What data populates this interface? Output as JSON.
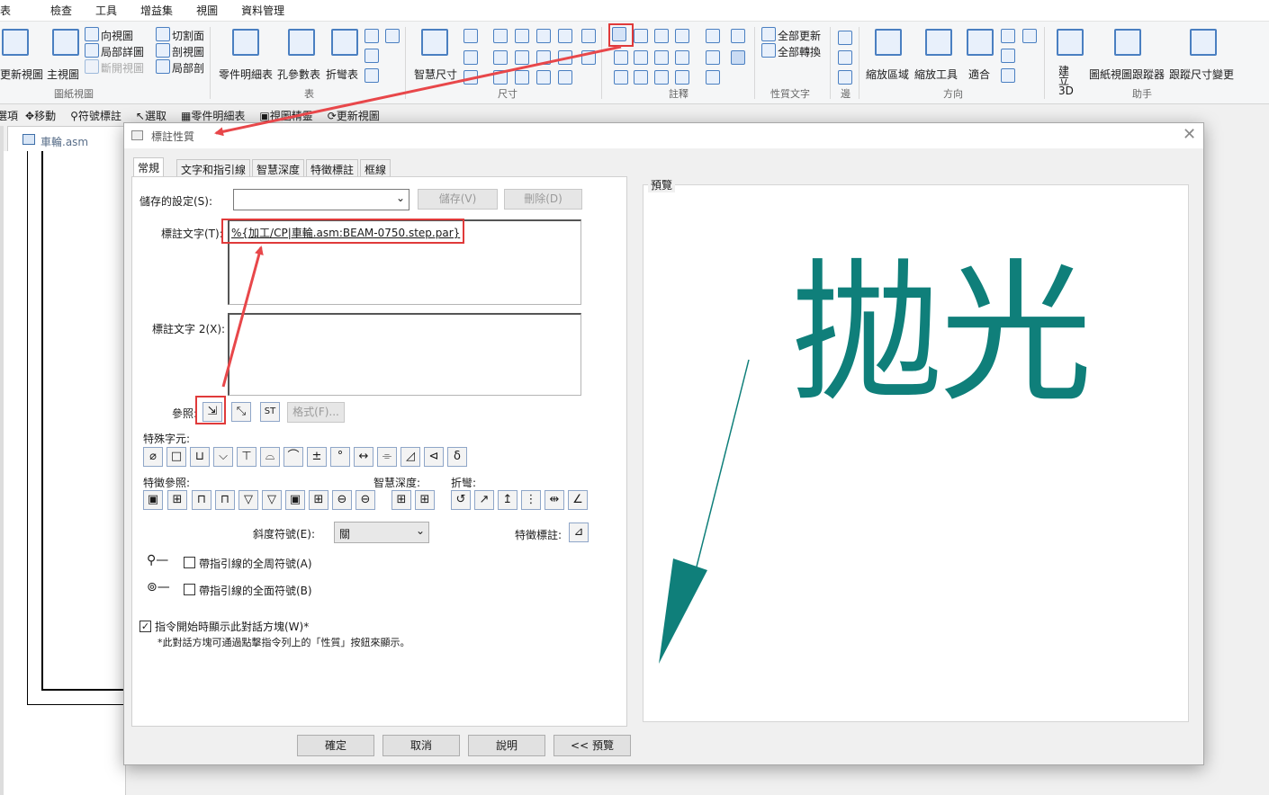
{
  "menubar": {
    "items": [
      "表",
      "檢查",
      "工具",
      "增益集",
      "視圖",
      "資料管理"
    ]
  },
  "ribbon": {
    "groups": {
      "drawing_views": "圖紙視圖",
      "tables": "表",
      "dimension": "尺寸",
      "annotation": "註釋",
      "property_text": "性質文字",
      "edge": "邊",
      "orientation": "方向",
      "assistant": "助手"
    },
    "buttons": {
      "update_views": "更新視圖",
      "main_view": "主視圖",
      "view_dir": "向視圖",
      "detail": "局部詳圖",
      "broken": "斷開視圖",
      "section": "切割面",
      "section_view": "剖視圖",
      "partial_section": "局部剖",
      "parts_list": "零件明細表",
      "hole_table": "孔參數表",
      "bend_table": "折彎表",
      "smart_dim": "智慧尺寸",
      "update_all": "全部更新",
      "convert_all": "全部轉換",
      "zoom_area": "縮放區域",
      "zoom_tool": "縮放工具",
      "fit": "適合",
      "create_3d": "建立3D",
      "view_tracker": "圖紙視圖跟蹤器",
      "track_dim": "跟蹤尺寸變更"
    }
  },
  "quickbar": {
    "items": [
      "選項",
      "移動",
      "符號標註",
      "選取",
      "零件明細表",
      "視圖精靈",
      "更新視圖"
    ]
  },
  "document": {
    "tab_name": "車輪.asm"
  },
  "dialog": {
    "title": "標註性質",
    "tabs": [
      "常規",
      "文字和指引線",
      "智慧深度",
      "特徵標註",
      "框線"
    ],
    "saved_settings_label": "儲存的設定(S):",
    "save_btn": "儲存(V)",
    "delete_btn": "刪除(D)",
    "callout_text_label": "標註文字(T):",
    "callout_text_value": "%{加工/CP|車輪.asm:BEAM-0750.step.par}",
    "callout_text2_label": "標註文字 2(X):",
    "reference_label": "參照:",
    "format_btn": "格式(F)...",
    "special_chars_label": "特殊字元:",
    "special_chars": [
      "⌀",
      "□",
      "⊔",
      "⌵",
      "⊤",
      "⌓",
      "⌒",
      "±",
      "°",
      "↔",
      "⌯",
      "◿",
      "⊲",
      "δ"
    ],
    "feature_ref_label": "特徵參照:",
    "smart_depth_label": "智慧深度:",
    "bend_label": "折彎:",
    "bevel_label": "斜度符號(E):",
    "bevel_value": "關",
    "feature_callout_label": "特徵標註:",
    "leader_all_around_label": "帶指引線的全周符號(A)",
    "leader_all_around2_label": "帶指引線的全面符號(B)",
    "show_on_start_label": "指令開始時顯示此對話方塊(W)*",
    "show_on_start_checked": true,
    "note": "*此對話方塊可通過點擊指令列上的「性質」按鈕來顯示。",
    "preview_label": "預覽",
    "preview_text": "拋光",
    "ok_btn": "確定",
    "cancel_btn": "取消",
    "help_btn": "說明",
    "preview_btn": "<< 預覽"
  },
  "colors": {
    "annotation_red": "#e03a3a",
    "preview_teal": "#0f7f7a"
  }
}
